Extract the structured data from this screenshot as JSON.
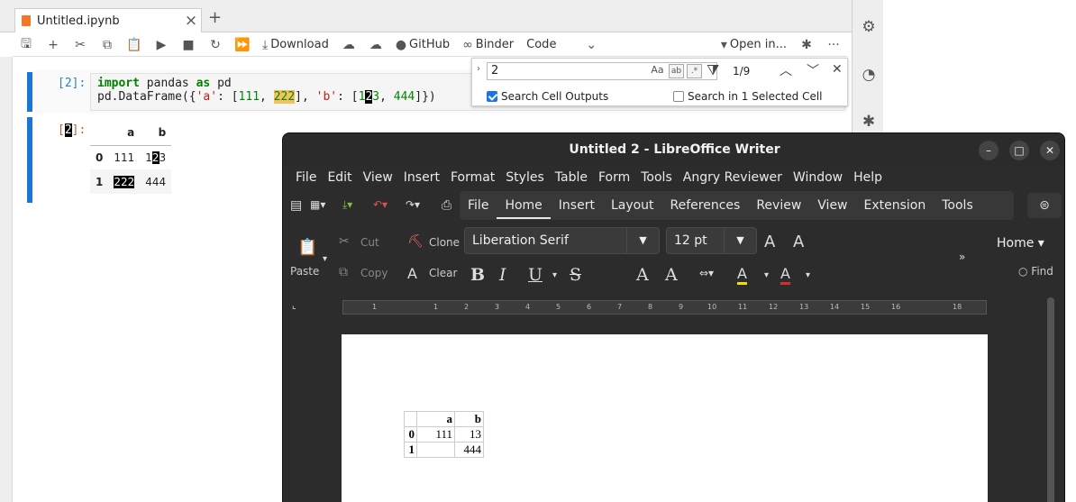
{
  "jupyter": {
    "tab_title": "Untitled.ipynb",
    "tab_close": "×",
    "new_tab": "+",
    "toolbar": {
      "download": "Download",
      "github": "GitHub",
      "binder": "Binder",
      "cell_type": "Code",
      "open_in": "Open in...",
      "more": "···"
    },
    "cell1": {
      "prompt": "[2]:",
      "line1": {
        "kw1": "import",
        "mod": " pandas ",
        "kw2": "as",
        "alias": " pd"
      },
      "line2": {
        "pre": "pd.DataFrame({",
        "a_key": "'a'",
        "sep1": ": [",
        "v1": "111",
        "sep2": ", ",
        "v2": "222",
        "sep3": "], ",
        "b_key": "'b'",
        "sep4": ": [",
        "v3a": "1",
        "v3b": "2",
        "v3c": "3",
        "sep5": ", ",
        "v4": "444",
        "end": "]})"
      }
    },
    "cell2": {
      "prompt_pre": "[",
      "prompt_hl": "2",
      "prompt_post": "]:",
      "table": {
        "columns": [
          "",
          "a",
          "b"
        ],
        "rows": [
          {
            "index": "0",
            "a": "111",
            "b_pre": "1",
            "b_hl": "2",
            "b_post": "3"
          },
          {
            "index": "1",
            "a": "222",
            "b": "444"
          }
        ]
      }
    },
    "search": {
      "query": "2",
      "count": "1/9",
      "search_outputs_label": "Search Cell Outputs",
      "search_outputs_checked": true,
      "search_selected_label": "Search in 1 Selected Cell",
      "search_selected_checked": false,
      "opt_case": "Aa",
      "opt_word": "ab",
      "opt_regex": ".*"
    }
  },
  "writer": {
    "title": "Untitled 2 - LibreOffice Writer",
    "menu": [
      "File",
      "Edit",
      "View",
      "Insert",
      "Format",
      "Styles",
      "Table",
      "Form",
      "Tools",
      "Angry Reviewer",
      "Window",
      "Help"
    ],
    "tabs": [
      "File",
      "Home",
      "Insert",
      "Layout",
      "References",
      "Review",
      "View",
      "Extension",
      "Tools"
    ],
    "active_tab": "Home",
    "clipboard": {
      "paste": "Paste",
      "cut": "Cut",
      "copy": "Copy",
      "clone": "Clone",
      "clear": "Clear"
    },
    "font_name": "Liberation Serif",
    "font_size": "12 pt",
    "style": "Home",
    "find": "Find",
    "ruler_marks": [
      "1",
      "1",
      "2",
      "3",
      "4",
      "5",
      "6",
      "7",
      "8",
      "9",
      "10",
      "11",
      "12",
      "13",
      "14",
      "15",
      "16",
      "18"
    ],
    "table": {
      "header": [
        "",
        "a",
        "b"
      ],
      "rows": [
        [
          "0",
          "111",
          "13"
        ],
        [
          "1",
          "",
          "444"
        ]
      ]
    }
  }
}
